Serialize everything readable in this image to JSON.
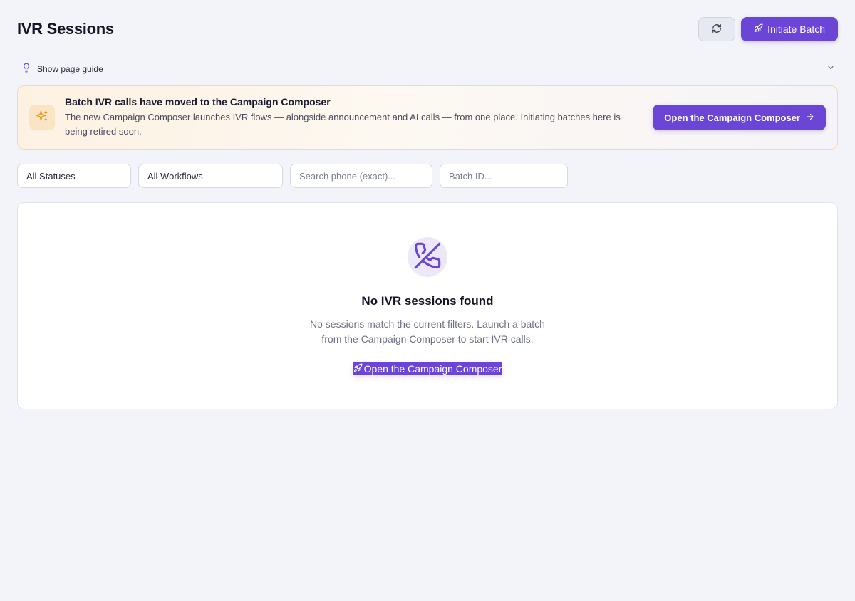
{
  "header": {
    "title": "IVR Sessions",
    "refresh_icon": "refresh-icon",
    "initiate_label": "Initiate Batch",
    "initiate_icon": "rocket-icon"
  },
  "guide": {
    "label": "Show page guide",
    "icon": "lightbulb-icon",
    "chevron": "chevron-down-icon"
  },
  "banner": {
    "title": "Batch IVR calls have moved to the Campaign Composer",
    "body": "The new Campaign Composer launches IVR flows — alongside announcement and AI calls — from one place. Initiating batches here is being retired soon.",
    "button_label": "Open the Campaign Composer",
    "icon": "sparkles-icon"
  },
  "filters": {
    "status": "All Statuses",
    "workflow": "All Workflows",
    "phone_placeholder": "Search phone (exact)...",
    "batch_placeholder": "Batch ID..."
  },
  "empty_state": {
    "icon": "phone-off-icon",
    "title": "No IVR sessions found",
    "description": "No sessions match the current filters. Launch a batch from the Campaign Composer to start IVR calls.",
    "link_label": "Open the Campaign Composer"
  },
  "colors": {
    "accent": "#6a45d6",
    "banner_bg": "#fdf1e2",
    "banner_icon": "#e09a2c",
    "page_bg": "#f3f4f9"
  }
}
